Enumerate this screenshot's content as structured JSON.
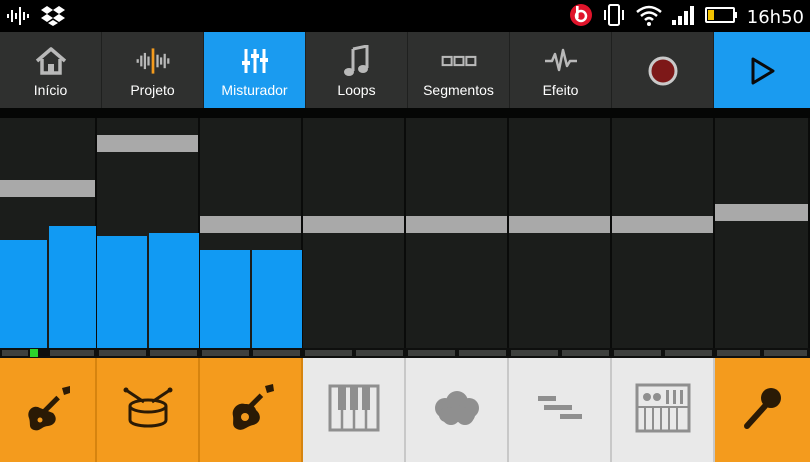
{
  "status_bar": {
    "time": "16h50",
    "icons": [
      "audio-wave-icon",
      "dropbox-icon",
      "beats-icon",
      "vibrate-icon",
      "wifi-icon",
      "signal-icon",
      "battery-icon"
    ]
  },
  "toolbar": {
    "tabs": [
      {
        "label": "Início",
        "icon": "home-icon",
        "active": false
      },
      {
        "label": "Projeto",
        "icon": "waveform-icon",
        "active": false
      },
      {
        "label": "Misturador",
        "icon": "mixer-sliders-icon",
        "active": true
      },
      {
        "label": "Loops",
        "icon": "music-note-icon",
        "active": false
      },
      {
        "label": "Segmentos",
        "icon": "segments-icon",
        "active": false
      },
      {
        "label": "Efeito",
        "icon": "pulse-icon",
        "active": false
      },
      {
        "label": "",
        "icon": "record-icon",
        "active": false
      },
      {
        "label": "",
        "icon": "play-icon",
        "active": true
      }
    ]
  },
  "mixer": {
    "channels": [
      {
        "name": "electric-guitar",
        "volume_level": 0.74,
        "meter_levels": [
          0.49,
          0.55
        ]
      },
      {
        "name": "drums",
        "volume_level": 0.93,
        "meter_levels": [
          0.51,
          0.52
        ]
      },
      {
        "name": "acoustic-guitar",
        "volume_level": 0.59,
        "meter_levels": [
          0.45,
          0.45
        ]
      },
      {
        "name": "piano",
        "volume_level": 0.59,
        "meter_levels": []
      },
      {
        "name": "ambient",
        "volume_level": 0.59,
        "meter_levels": []
      },
      {
        "name": "segments",
        "volume_level": 0.59,
        "meter_levels": []
      },
      {
        "name": "synth",
        "volume_level": 0.59,
        "meter_levels": []
      },
      {
        "name": "vocal",
        "volume_level": 0.64,
        "meter_levels": []
      }
    ]
  },
  "instruments": [
    {
      "icon": "electric-guitar-icon",
      "color": "#f49b1d"
    },
    {
      "icon": "drum-icon",
      "color": "#f49b1d"
    },
    {
      "icon": "acoustic-guitar-icon",
      "color": "#f49b1d"
    },
    {
      "icon": "piano-icon",
      "color": "#e9e9e9"
    },
    {
      "icon": "cloud-icon",
      "color": "#e9e9e9"
    },
    {
      "icon": "segments-bars-icon",
      "color": "#e9e9e9"
    },
    {
      "icon": "synth-keyboard-icon",
      "color": "#e9e9e9"
    },
    {
      "icon": "microphone-icon",
      "color": "#f49b1d"
    }
  ],
  "colors": {
    "accent": "#1a9bf0",
    "meter": "#119af3",
    "handle": "#a9a9a9",
    "orange": "#f49b1d",
    "indicator": "#2bd42b"
  }
}
